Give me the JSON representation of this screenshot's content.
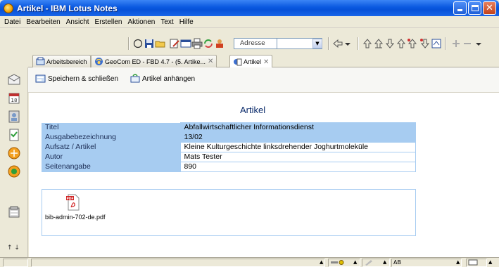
{
  "window": {
    "title": "Artikel - IBM Lotus Notes"
  },
  "menu": [
    "Datei",
    "Bearbeiten",
    "Ansicht",
    "Erstellen",
    "Aktionen",
    "Text",
    "Hilfe"
  ],
  "toolbar": {
    "address_label": "Adresse",
    "address_value": ""
  },
  "tabs": [
    {
      "label": "Arbeitsbereich",
      "icon": "workspace-icon",
      "closable": false,
      "active": false
    },
    {
      "label": "GeoCom ED - FBD 4.7 - (5. Artike...",
      "icon": "database-icon",
      "closable": true,
      "active": false
    },
    {
      "label": "Artikel",
      "icon": "document-icon",
      "closable": true,
      "active": true
    }
  ],
  "actions": {
    "save_close": "Speichern & schließen",
    "attach": "Artikel anhängen"
  },
  "document": {
    "heading": "Artikel",
    "fields": [
      {
        "label": "Titel",
        "value": "Abfallwirtschaftlicher Informationsdienst"
      },
      {
        "label": "Ausgabebezeichnung",
        "value": "13/02"
      },
      {
        "label": "Aufsatz / Artikel",
        "value": "Kleine Kulturgeschichte linksdrehender Joghurtmoleküle"
      },
      {
        "label": "Autor",
        "value": "Mats Tester"
      },
      {
        "label": "Seitenangabe",
        "value": "890"
      }
    ],
    "attachment": {
      "icon": "pdf-file-icon",
      "filename": "bib-admin-702-de.pdf"
    }
  },
  "statusbar": {
    "location": "AB"
  },
  "colors": {
    "title_bar": "#0a58e0",
    "field_label_bg": "#a7ccf1",
    "heading": "#0a2a6a"
  }
}
